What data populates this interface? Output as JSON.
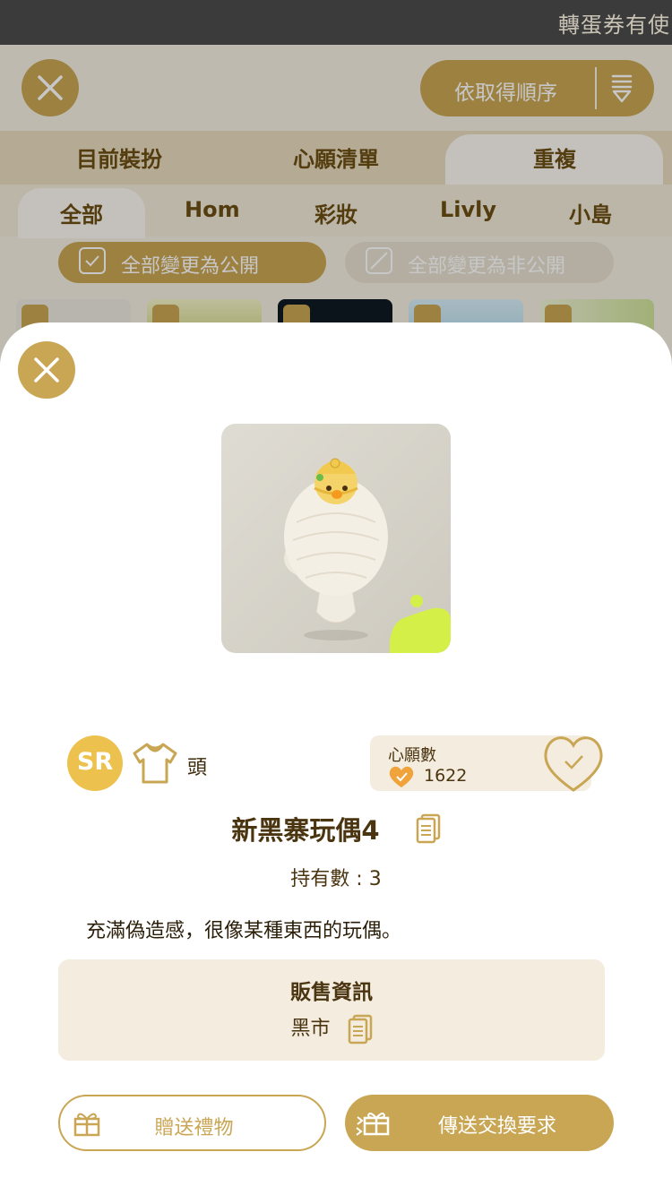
{
  "status_bar": {
    "text": "轉蛋券有使"
  },
  "background": {
    "sort_label": "依取得順序",
    "tabs": [
      {
        "label": "目前裝扮"
      },
      {
        "label": "心願清單"
      },
      {
        "label": "重複"
      }
    ],
    "active_tab": "重複",
    "subtabs": [
      {
        "label": "全部"
      },
      {
        "label": "Hom"
      },
      {
        "label": "彩妝"
      },
      {
        "label": "Livly"
      },
      {
        "label": "小島"
      }
    ],
    "active_subtab": "全部",
    "make_public_label": "全部變更為公開",
    "make_private_label": "全部變更為非公開"
  },
  "item": {
    "rarity": "SR",
    "slot_icon": "shirt-icon",
    "slot": "頭",
    "wish_label": "心願數",
    "wish_count": "1622",
    "name": "新黑寨玩偶4",
    "owned": "持有數 : 3",
    "description": "充滿偽造感，很像某種東西的玩偶。",
    "sale_title": "販售資訊",
    "sale_value": "黑市",
    "gift_label": "贈送禮物",
    "trade_label": "傳送交換要求"
  },
  "colors": {
    "gold": "#c9a654",
    "sr_badge": "#ecc14d",
    "heart_orange": "#f0a33a",
    "text_brown": "#4a3510"
  }
}
